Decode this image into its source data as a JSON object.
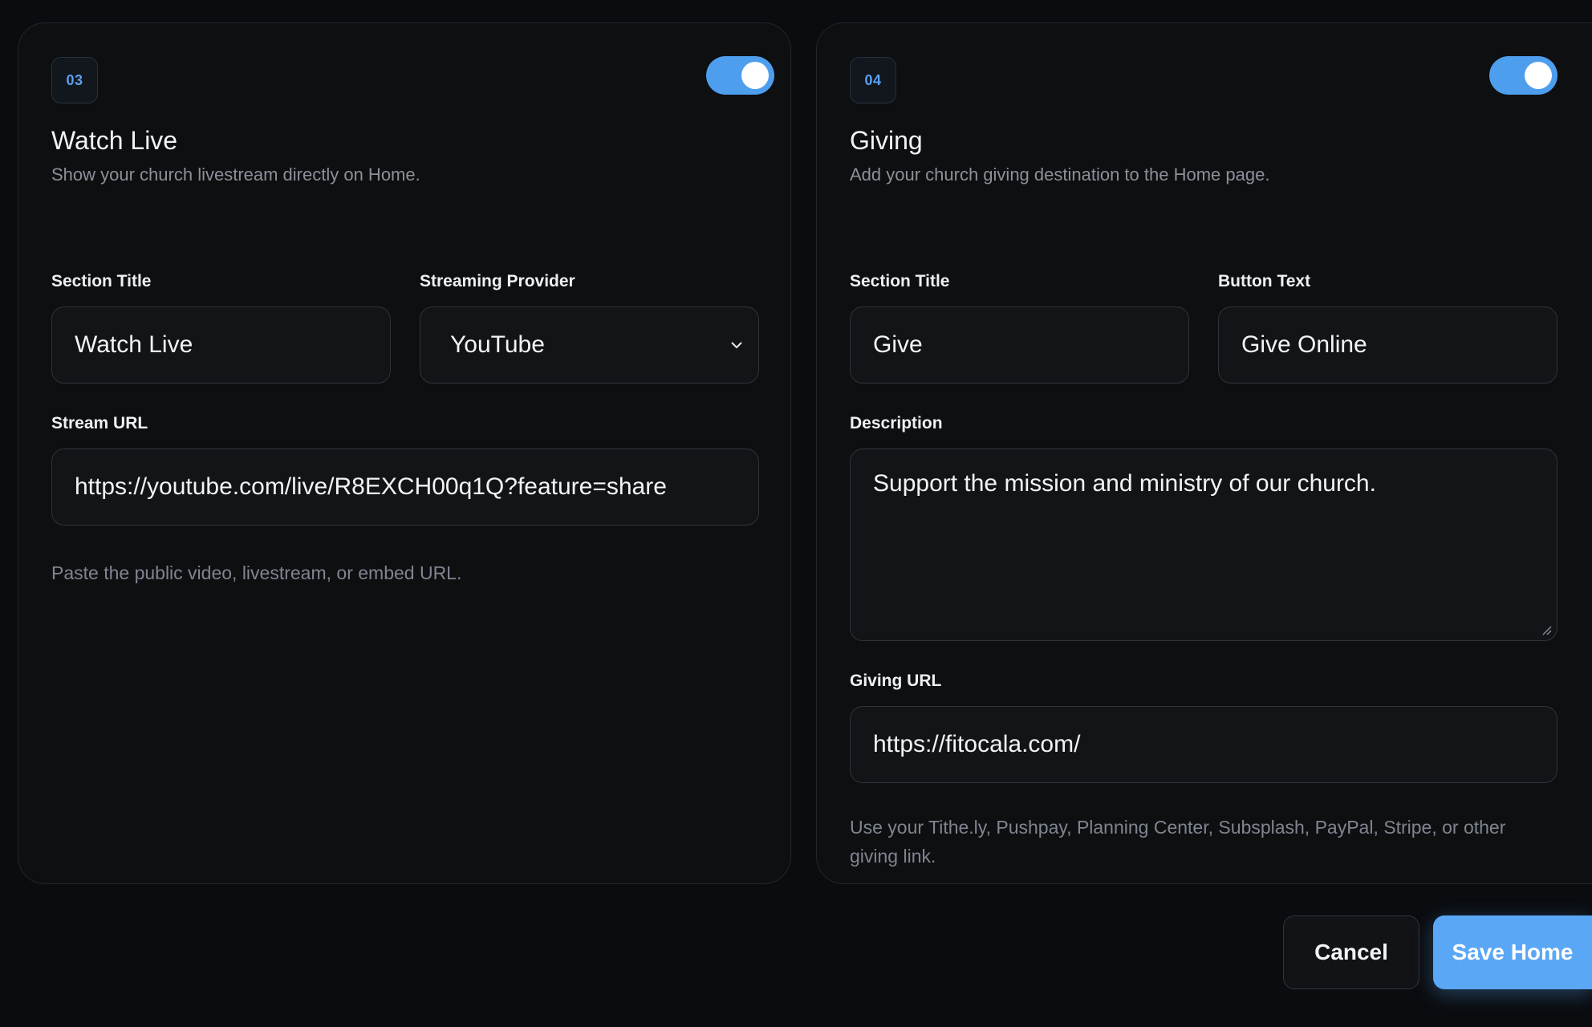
{
  "watch_live": {
    "number": "03",
    "enabled": true,
    "title": "Watch Live",
    "description": "Show your church livestream directly on Home.",
    "section_title_label": "Section Title",
    "section_title_value": "Watch Live",
    "provider_label": "Streaming Provider",
    "provider_value": "YouTube",
    "stream_url_label": "Stream URL",
    "stream_url_value": "https://youtube.com/live/R8EXCH00q1Q?feature=share",
    "stream_url_help": "Paste the public video, livestream, or embed URL."
  },
  "giving": {
    "number": "04",
    "enabled": true,
    "title": "Giving",
    "description": "Add your church giving destination to the Home page.",
    "section_title_label": "Section Title",
    "section_title_value": "Give",
    "button_text_label": "Button Text",
    "button_text_value": "Give Online",
    "description_label": "Description",
    "description_value": "Support the mission and ministry of our church.",
    "giving_url_label": "Giving URL",
    "giving_url_value": "https://fitocala.com/",
    "giving_url_help": "Use your Tithe.ly, Pushpay, Planning Center, Subsplash, PayPal, Stripe, or other giving link."
  },
  "actions": {
    "cancel_label": "Cancel",
    "save_label": "Save Home"
  },
  "colors": {
    "accent": "#5aa7f5",
    "background": "#0a0c0f",
    "card": "#0e0f11"
  }
}
